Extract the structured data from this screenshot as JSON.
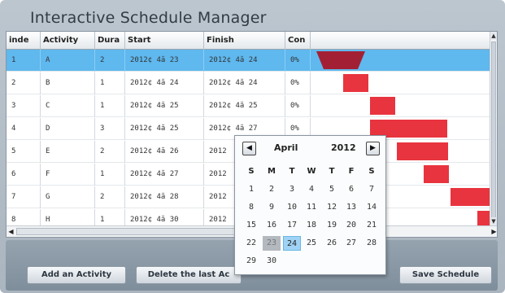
{
  "app": {
    "title": "Interactive Schedule Manager"
  },
  "columns": [
    "inde",
    "Activity",
    "Dura",
    "Start",
    "Finish",
    "Con"
  ],
  "rows": [
    {
      "index": "1",
      "activity": "A",
      "duration": "2",
      "start": "2012¢ 4ă 23",
      "finish": "2012¢ 4ă 24",
      "complete": "0%"
    },
    {
      "index": "2",
      "activity": "B",
      "duration": "1",
      "start": "2012¢ 4ă 24",
      "finish": "2012¢ 4ă 24",
      "complete": "0%"
    },
    {
      "index": "3",
      "activity": "C",
      "duration": "1",
      "start": "2012¢ 4ă 25",
      "finish": "2012¢ 4ă 25",
      "complete": "0%"
    },
    {
      "index": "4",
      "activity": "D",
      "duration": "3",
      "start": "2012¢ 4ă 25",
      "finish": "2012¢ 4ă 27",
      "complete": "0%"
    },
    {
      "index": "5",
      "activity": "E",
      "duration": "2",
      "start": "2012¢ 4ă 26",
      "finish": "2012",
      "complete": ""
    },
    {
      "index": "6",
      "activity": "F",
      "duration": "1",
      "start": "2012¢ 4ă 27",
      "finish": "2012",
      "complete": ""
    },
    {
      "index": "7",
      "activity": "G",
      "duration": "2",
      "start": "2012¢ 4ă 28",
      "finish": "2012",
      "complete": ""
    },
    {
      "index": "8",
      "activity": "H",
      "duration": "1",
      "start": "2012¢ 4ă 30",
      "finish": "2012",
      "complete": ""
    }
  ],
  "gantt": {
    "bar_color": "#e8343f",
    "summary_color": "#a32034"
  },
  "calendar": {
    "month": "April",
    "year": "2012",
    "prev_icon": "◀",
    "next_icon": "▶",
    "weekdays": [
      "S",
      "M",
      "T",
      "W",
      "T",
      "F",
      "S"
    ],
    "weeks": [
      [
        "1",
        "2",
        "3",
        "4",
        "5",
        "6",
        "7"
      ],
      [
        "8",
        "9",
        "10",
        "11",
        "12",
        "13",
        "14"
      ],
      [
        "15",
        "16",
        "17",
        "18",
        "19",
        "20",
        "21"
      ],
      [
        "22",
        "23",
        "24",
        "25",
        "26",
        "27",
        "28"
      ],
      [
        "29",
        "30",
        "",
        "",
        "",
        "",
        ""
      ]
    ],
    "today": "23",
    "selected": "24"
  },
  "buttons": {
    "add": "Add an Activity",
    "delete": "Delete the last Ac",
    "save": "Save Schedule"
  },
  "scroll": {
    "up": "▲",
    "down": "▼",
    "left": "◀",
    "right": "▶",
    "grip": "≡"
  },
  "colors": {
    "selected_row": "#5fb8ee",
    "calendar_selected": "#9fd3f5"
  }
}
